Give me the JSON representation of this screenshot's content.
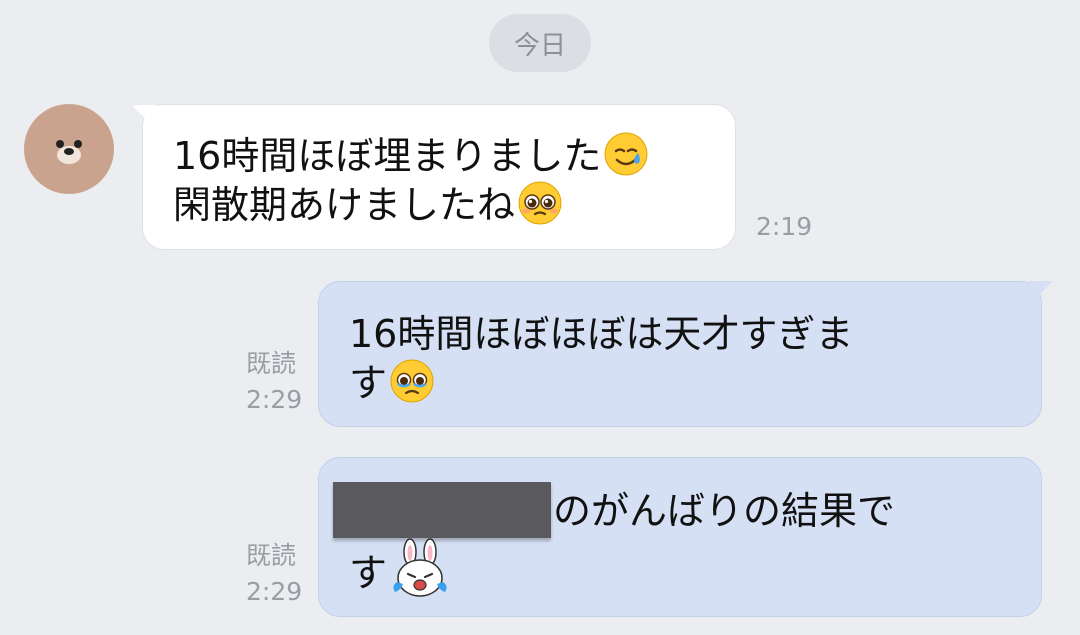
{
  "chat": {
    "date_label": "今日",
    "messages": [
      {
        "side": "incoming",
        "sender": "dog avatar",
        "line1": "16時間ほぼ埋まりました",
        "line1_emoji": "smiling-face-with-tear",
        "line2": "閑散期あけましたね",
        "line2_emoji": "pleading-face",
        "time": "2:19"
      },
      {
        "side": "outgoing",
        "line1": "16時間ほぼほぼは天才すぎま",
        "line2": "す",
        "line2_emoji": "face-holding-back-tears",
        "read": "既読",
        "time": "2:29"
      },
      {
        "side": "outgoing",
        "redacted": true,
        "line1": "のがんばりの結果で",
        "line2": "す",
        "line2_emoji": "crying-bunny-sticker",
        "read": "既読",
        "time": "2:29"
      }
    ]
  },
  "colors": {
    "background": "#ecedf1",
    "incoming_bubble": "#ffffff",
    "outgoing_bubble": "#d5e0f4",
    "meta_text": "#9a9da4"
  }
}
